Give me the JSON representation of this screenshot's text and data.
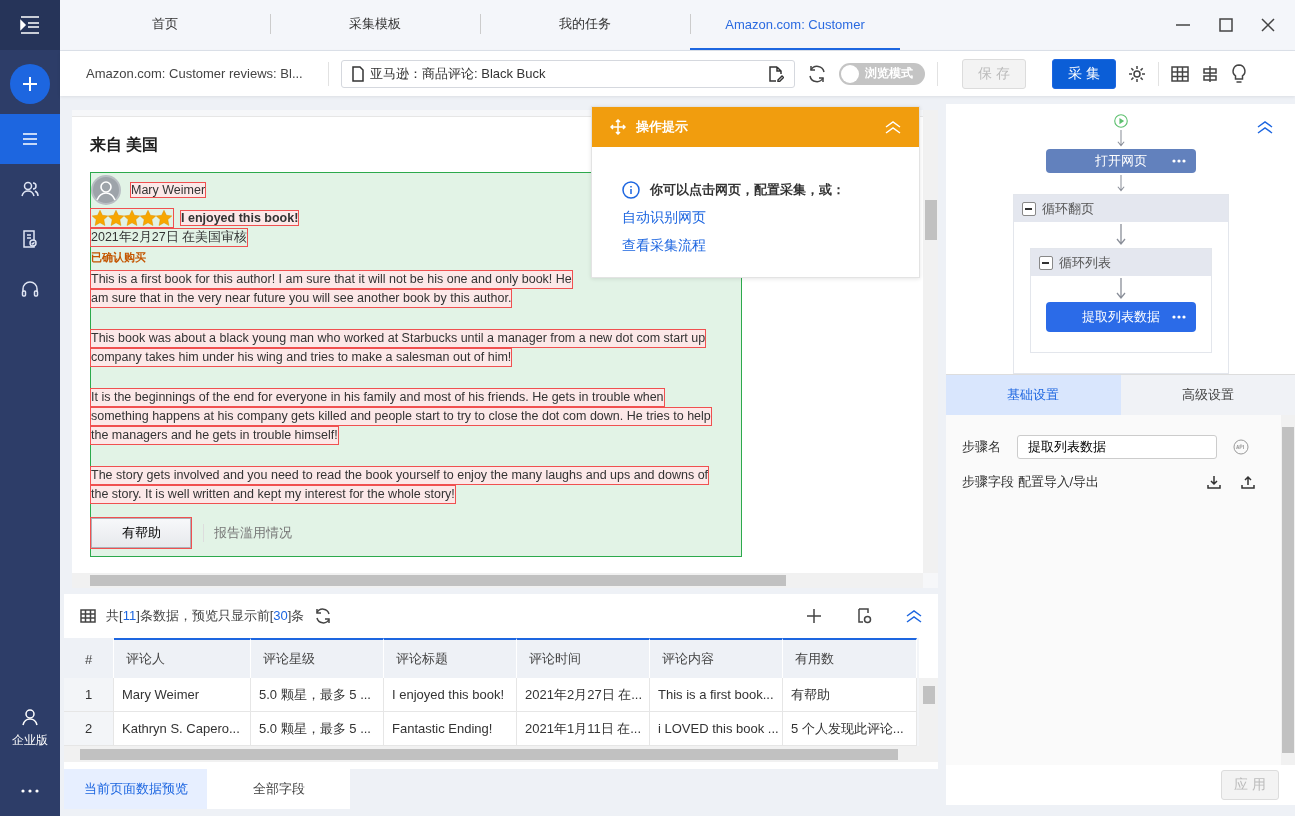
{
  "sidebar": {
    "items": [
      {
        "kind": "list",
        "selected": true
      },
      {
        "kind": "people",
        "selected": false
      },
      {
        "kind": "doc",
        "selected": false
      },
      {
        "kind": "headset",
        "selected": false
      }
    ],
    "account": {
      "label": "企业版"
    }
  },
  "tabs": [
    {
      "label": "首页",
      "selected": false
    },
    {
      "label": "采集模板",
      "selected": false
    },
    {
      "label": "我的任务",
      "selected": false
    },
    {
      "label": "Amazon.com: Customer",
      "selected": true
    }
  ],
  "toolbar": {
    "page_title": "Amazon.com: Customer reviews: Bl...",
    "url": "亚马逊：商品评论: Black Buck",
    "browse_mode": {
      "label": "浏览模式",
      "on": false
    },
    "save": {
      "label": "保 存",
      "disabled": true
    },
    "collect": {
      "label": "采 集",
      "disabled": false
    }
  },
  "page": {
    "heading": "来自 美国",
    "review": {
      "reviewer": "Mary Weimer",
      "stars": 5,
      "title": "I enjoyed this book!",
      "date": "2021年2月27日 在美国审核",
      "verified": "已确认购买",
      "paragraphs": [
        [
          "This is a first book for this author! I am sure that it will not be his one and only book! He",
          "am sure that in the very near future you will see another book by this author."
        ],
        [
          "This book was about a black young man who worked at Starbucks until a manager from a new dot com start up",
          "company takes him under his wing and tries to make a salesman out of him!"
        ],
        [
          "It is the beginnings of the end for everyone in his family and most of his friends. He gets in trouble when",
          "something happens at his company gets killed and people start to try to close the dot com down. He tries to help",
          "the managers and he gets in trouble himself!"
        ],
        [
          "The story gets involved and you need to read the book yourself to enjoy the many laughs and ups and downs of",
          "the story. It is well written and kept my interest for the whole story!"
        ]
      ],
      "helpful_button": "有帮助",
      "report_link": "报告滥用情况"
    }
  },
  "tip": {
    "title": "操作提示",
    "message": "你可以点击网页，配置采集，或：",
    "links": [
      "自动识别网页",
      "查看采集流程"
    ]
  },
  "data_panel": {
    "summary": [
      "共[",
      "11",
      "]条数据，预览只显示前[",
      "30",
      "]条"
    ],
    "table": {
      "columns": [
        "#",
        "评论人",
        "评论星级",
        "评论标题",
        "评论时间",
        "评论内容",
        "有用数"
      ],
      "rows": [
        [
          "1",
          "Mary Weimer",
          "5.0 颗星，最多 5 ...",
          "I enjoyed this book!",
          "2021年2月27日 在...",
          "This is a first book...",
          "有帮助"
        ],
        [
          "2",
          "Kathryn S. Capero...",
          "5.0 颗星，最多 5 ...",
          "Fantastic Ending!",
          "2021年1月11日 在...",
          "i LOVED this book ...",
          "5 个人发现此评论..."
        ]
      ]
    },
    "tabs": [
      {
        "label": "当前页面数据预览",
        "selected": true
      },
      {
        "label": "全部字段",
        "selected": false
      }
    ]
  },
  "flow": {
    "steps": [
      {
        "kind": "action",
        "label": "打开网页",
        "selected": false
      },
      {
        "kind": "loop",
        "label": "循环翻页",
        "expanded": true,
        "children": [
          {
            "kind": "loop",
            "label": "循环列表",
            "expanded": true,
            "children": [
              {
                "kind": "action",
                "label": "提取列表数据",
                "selected": true
              }
            ]
          }
        ]
      }
    ]
  },
  "settings": {
    "tabs": [
      {
        "label": "基础设置",
        "selected": true
      },
      {
        "label": "高级设置",
        "selected": false
      }
    ],
    "step_name": {
      "label": "步骤名",
      "value": "提取列表数据"
    },
    "fields_label": "步骤字段 配置导入/导出",
    "apply": {
      "label": "应 用",
      "disabled": true
    }
  }
}
